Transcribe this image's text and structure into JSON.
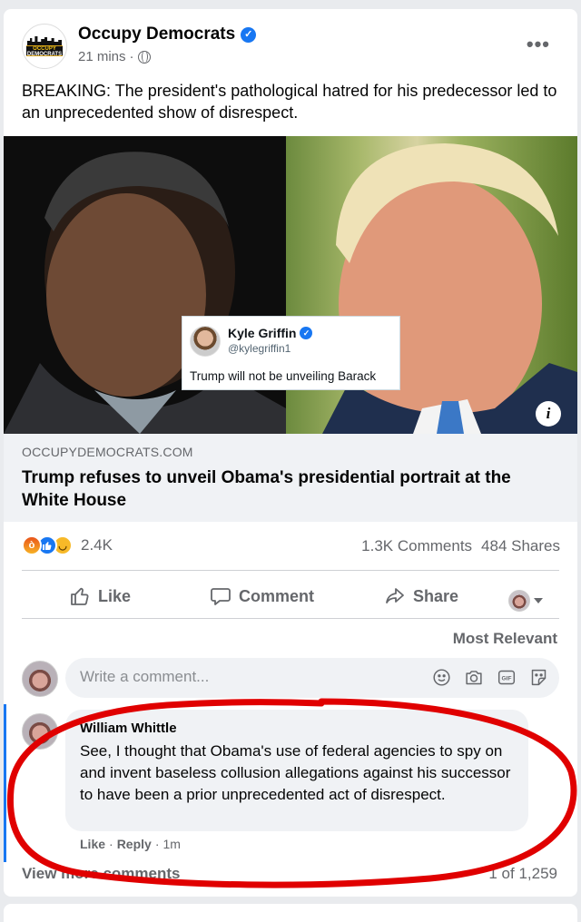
{
  "post": {
    "page_name": "Occupy Democrats",
    "logo_text_1": "OCCUPY",
    "logo_text_2": "DEMOCRATS",
    "time": "21 mins",
    "separator": "·",
    "body_text": "BREAKING: The president's pathological hatred for his predecessor led to an unprecedented show of disrespect."
  },
  "tweet": {
    "name": "Kyle Griffin",
    "handle": "@kylegriffin1",
    "text": "Trump will not be unveiling Barack"
  },
  "link": {
    "domain": "OCCUPYDEMOCRATS.COM",
    "title": "Trump refuses to unveil Obama's presidential portrait at the White House"
  },
  "stats": {
    "reactions": "2.4K",
    "comments": "1.3K Comments",
    "shares": "484 Shares"
  },
  "actions": {
    "like": "Like",
    "comment": "Comment",
    "share": "Share"
  },
  "comments_section": {
    "sort_label": "Most Relevant",
    "write_placeholder": "Write a comment...",
    "view_more": "View more comments",
    "pager": "1 of 1,259"
  },
  "comment": {
    "author": "William Whittle",
    "text": "See, I thought that Obama's use of federal agencies to spy on and invent baseless collusion allegations against his successor to have been a prior unprecedented act of disrespect.",
    "like": "Like",
    "reply": "Reply",
    "time": "1m",
    "dot": "·"
  },
  "colors": {
    "brand_blue": "#1877f2",
    "annotation_red": "#e00000",
    "secondary_text": "#65676b"
  },
  "icons": [
    "verified-badge-icon",
    "globe-icon",
    "more-icon",
    "info-icon",
    "angry-reaction-icon",
    "like-reaction-icon",
    "haha-reaction-icon",
    "thumbs-up-icon",
    "comment-icon",
    "share-icon",
    "emoji-icon",
    "camera-icon",
    "gif-icon",
    "sticker-icon"
  ]
}
